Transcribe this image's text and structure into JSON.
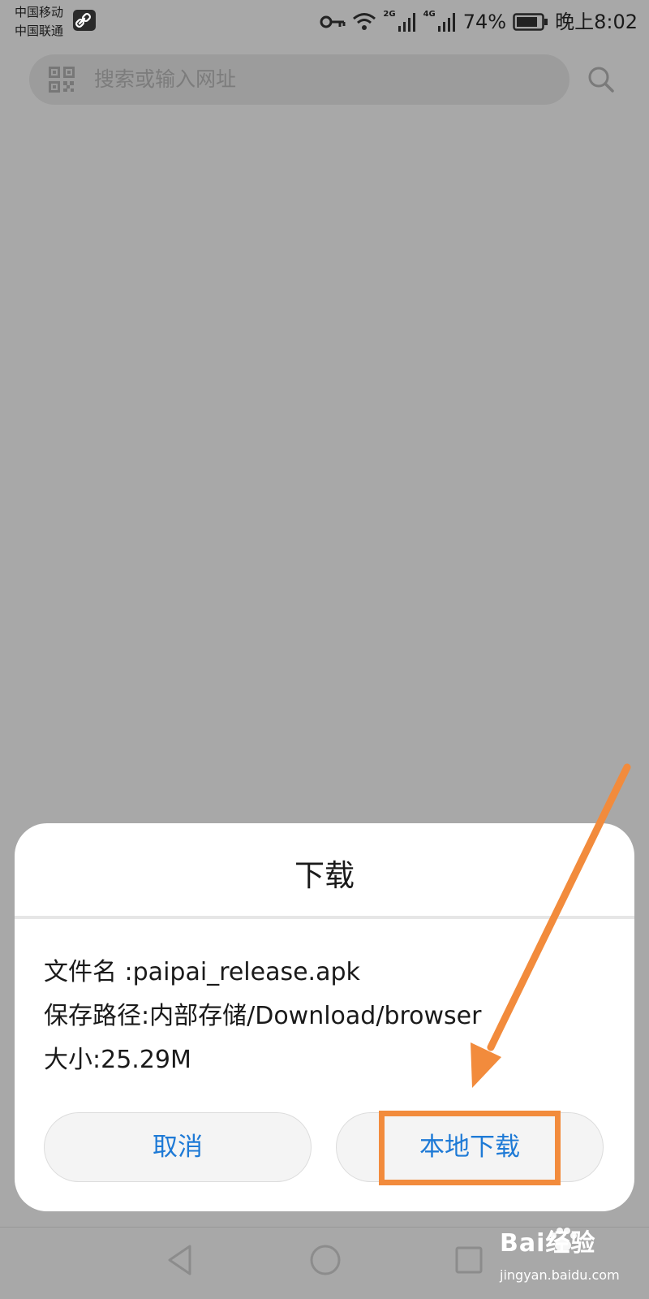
{
  "status_bar": {
    "carrier_1": "中国移动",
    "carrier_2": "中国联通",
    "net_1": "2G",
    "net_2": "4G",
    "battery_percent": "74%",
    "time": "晚上8:02"
  },
  "search": {
    "placeholder": "搜索或输入网址"
  },
  "dialog": {
    "title": "下载",
    "file_name_line": "文件名 :paipai_release.apk",
    "save_path_line": "保存路径:内部存储/Download/browser",
    "size_line": "大小:25.29M",
    "cancel_label": "取消",
    "download_label": "本地下载"
  },
  "annotation": {
    "highlight_color": "#f28b3c"
  },
  "watermark": {
    "brand": "Bai经验",
    "url": "jingyan.baidu.com"
  },
  "colors": {
    "accent": "#1e7ad6",
    "overlay": "#a8a8a8"
  }
}
